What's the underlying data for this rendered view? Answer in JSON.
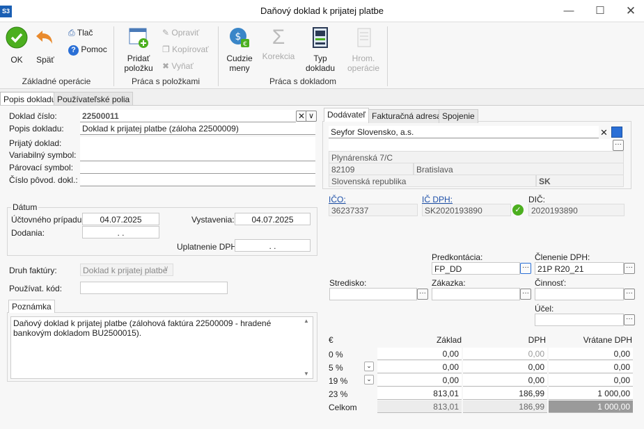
{
  "window": {
    "logo": "S3",
    "title": "Daňový doklad k prijatej platbe"
  },
  "ribbon": {
    "ok": "OK",
    "back": "Späť",
    "print": "Tlač",
    "help": "Pomoc",
    "group1": "Základné operácie",
    "add_l1": "Pridať",
    "add_l2": "položku",
    "edit": "Opraviť",
    "copy": "Kopírovať",
    "remove": "Vyňať",
    "group2": "Práca s položkami",
    "curr_l1": "Cudzie",
    "curr_l2": "meny",
    "corr": "Korekcia",
    "type_l1": "Typ",
    "type_l2": "dokladu",
    "bulk_l1": "Hrom.",
    "bulk_l2": "operácie",
    "group3": "Práca s dokladom"
  },
  "tabs": [
    "Popis dokladu",
    "Používateľské polia"
  ],
  "form": {
    "doc_no_label": "Doklad číslo:",
    "doc_no": "22500011",
    "desc_label": "Popis dokladu:",
    "desc": "Doklad k prijatej platbe (záloha 22500009)",
    "received_label": "Prijatý doklad:",
    "variable_label": "Variabilný symbol:",
    "pairing_label": "Párovací symbol:",
    "orig_label": "Číslo pôvod. dokl.:",
    "date_group": "Dátum",
    "acc_label": "Účtovného prípadu:",
    "acc_date": "04.07.2025",
    "issue_label": "Vystavenia:",
    "issue_date": "04.07.2025",
    "deliv_label": "Dodania:",
    "empty_date": ". .",
    "vat_app_label": "Uplatnenie DPH:",
    "inv_type_label": "Druh faktúry:",
    "inv_type": "Doklad k prijatej platbe",
    "user_code_label": "Používat. kód:",
    "note_tab": "Poznámka",
    "note": "Daňový doklad k prijatej platbe (zálohová faktúra 22500009 - hradené bankovým dokladom BU2500015)."
  },
  "supplier": {
    "tabs": [
      "Dodávateľ",
      "Fakturačná adresa",
      "Spojenie"
    ],
    "name": "Seyfor Slovensko, a.s.",
    "street": "Plynárenská 7/C",
    "zip": "82109",
    "city": "Bratislava",
    "country": "Slovenská republika",
    "country_code": "SK",
    "ico_label": "IČO:",
    "ico": "36237337",
    "icdph_label": "IČ DPH:",
    "icdph": "SK2020193890",
    "dic_label": "DIČ:",
    "dic": "2020193890"
  },
  "accounting": {
    "predkont_label": "Predkontácia:",
    "predkont": "FP_DD",
    "clen_label": "Členenie DPH:",
    "clen": "21P R20_21",
    "stredisko_label": "Stredisko:",
    "zakazka_label": "Zákazka:",
    "cinnost_label": "Činnosť:",
    "ucel_label": "Účel:"
  },
  "vat_table": {
    "currency": "€",
    "col_base": "Základ",
    "col_vat": "DPH",
    "col_total": "Vrátane DPH",
    "rows": [
      {
        "label": "0 %",
        "base": "0,00",
        "vat": "0,00",
        "total": "0,00"
      },
      {
        "label": "5 %",
        "base": "0,00",
        "vat": "0,00",
        "total": "0,00"
      },
      {
        "label": "19 %",
        "base": "0,00",
        "vat": "0,00",
        "total": "0,00"
      },
      {
        "label": "23 %",
        "base": "813,01",
        "vat": "186,99",
        "total": "1 000,00"
      }
    ],
    "sum": {
      "label": "Celkom",
      "base": "813,01",
      "vat": "186,99",
      "total": "1 000,00"
    }
  }
}
